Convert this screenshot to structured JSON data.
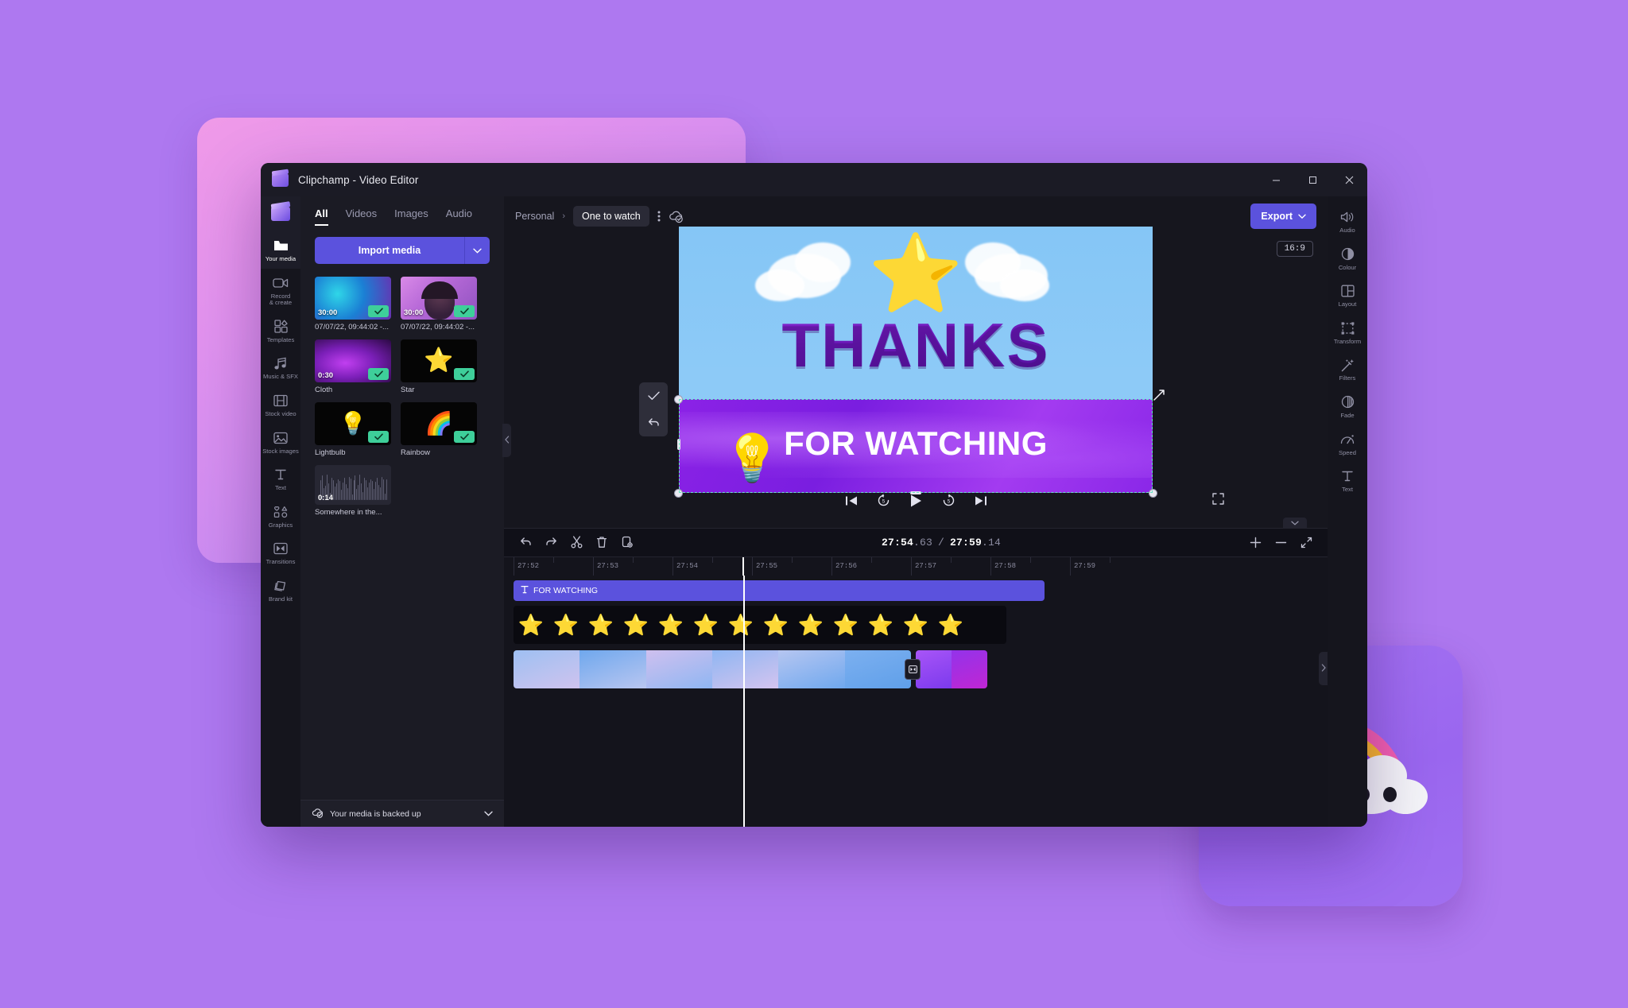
{
  "window": {
    "title": "Clipchamp - Video Editor",
    "controls": {
      "minimize": "—",
      "maximize": "□",
      "close": "✕"
    }
  },
  "left_rail": {
    "items": [
      {
        "label": "Your media",
        "icon": "folder-icon",
        "active": true
      },
      {
        "label": "Record\n& create",
        "icon": "camera-icon",
        "active": false
      },
      {
        "label": "Templates",
        "icon": "templates-icon",
        "active": false
      },
      {
        "label": "Music & SFX",
        "icon": "music-note-icon",
        "active": false
      },
      {
        "label": "Stock video",
        "icon": "film-icon",
        "active": false
      },
      {
        "label": "Stock images",
        "icon": "image-icon",
        "active": false
      },
      {
        "label": "Text",
        "icon": "text-t-icon",
        "active": false
      },
      {
        "label": "Graphics",
        "icon": "shapes-icon",
        "active": false
      },
      {
        "label": "Transitions",
        "icon": "transition-icon",
        "active": false
      },
      {
        "label": "Brand kit",
        "icon": "brand-kit-icon",
        "active": false
      }
    ]
  },
  "media_panel": {
    "tabs": [
      {
        "label": "All",
        "active": true
      },
      {
        "label": "Videos",
        "active": false
      },
      {
        "label": "Images",
        "active": false
      },
      {
        "label": "Audio",
        "active": false
      }
    ],
    "import_button": "Import media",
    "import_caret_icon": "chevron-down-icon",
    "items": [
      {
        "name": "07/07/22, 09:44:02 -...",
        "duration": "30:00",
        "kind": "video",
        "selected": true
      },
      {
        "name": "07/07/22, 09:44:02 -...",
        "duration": "30:00",
        "kind": "video",
        "selected": true
      },
      {
        "name": "Cloth",
        "duration": "0:30",
        "kind": "video",
        "selected": true
      },
      {
        "name": "Star",
        "duration": "",
        "kind": "graphic",
        "selected": true
      },
      {
        "name": "Lightbulb",
        "duration": "",
        "kind": "graphic",
        "selected": true
      },
      {
        "name": "Rainbow",
        "duration": "",
        "kind": "graphic",
        "selected": true
      },
      {
        "name": "Somewhere in the...",
        "duration": "0:14",
        "kind": "audio",
        "selected": false
      }
    ],
    "backup_status": "Your media is backed up",
    "backup_icon": "cloud-check-icon",
    "backup_caret_icon": "chevron-down-icon",
    "collapse_icon": "chevron-left-icon"
  },
  "topbar": {
    "breadcrumb_root": "Personal",
    "breadcrumb_separator": "›",
    "project_name": "One to watch",
    "more_icon": "more-vertical-icon",
    "sync_icon": "cloud-check-icon",
    "export_label": "Export",
    "export_caret_icon": "chevron-down-icon"
  },
  "preview": {
    "aspect_ratio": "16:9",
    "headline": "THANKS",
    "subheadline": "FOR WATCHING",
    "floating_tools": [
      {
        "icon": "check-icon",
        "name": "confirm"
      },
      {
        "icon": "undo-icon",
        "name": "revert"
      }
    ],
    "rotate_icon": "rotate-handle-icon",
    "playback_controls": [
      {
        "icon": "skip-start-icon",
        "name": "jump-to-start"
      },
      {
        "icon": "rewind-5-icon",
        "name": "rewind-five-seconds"
      },
      {
        "icon": "play-icon",
        "name": "play"
      },
      {
        "icon": "forward-5-icon",
        "name": "forward-five-seconds"
      },
      {
        "icon": "skip-end-icon",
        "name": "jump-to-end"
      }
    ],
    "fullscreen_icon": "fullscreen-icon"
  },
  "timeline": {
    "collapse_icon": "chevron-down-icon",
    "tools": [
      {
        "icon": "undo-icon",
        "name": "undo"
      },
      {
        "icon": "redo-icon",
        "name": "redo"
      },
      {
        "icon": "scissors-icon",
        "name": "split"
      },
      {
        "icon": "trash-icon",
        "name": "delete"
      },
      {
        "icon": "duplicate-icon",
        "name": "duplicate"
      }
    ],
    "current_time_major": "27:54",
    "current_time_minor": ".63",
    "total_time_major": "27:59",
    "total_time_minor": ".14",
    "time_separator": "/",
    "zoom_in_icon": "plus-icon",
    "zoom_out_icon": "minus-icon",
    "fit_icon": "fit-to-screen-icon",
    "ruler_ticks": [
      "27:52",
      "27:53",
      "27:54",
      "27:55",
      "27:56",
      "27:57",
      "27:58",
      "27:59"
    ],
    "text_clip": {
      "label": "FOR WATCHING",
      "icon": "text-t-icon"
    },
    "sticker_clip": {
      "emoji": "⭐",
      "count": 13
    },
    "transition_marker_icon": "transition-icon"
  },
  "right_rail": {
    "items": [
      {
        "label": "Audio",
        "icon": "speaker-icon"
      },
      {
        "label": "Colour",
        "icon": "contrast-icon"
      },
      {
        "label": "Layout",
        "icon": "layout-icon"
      },
      {
        "label": "Transform",
        "icon": "transform-icon"
      },
      {
        "label": "Filters",
        "icon": "magic-wand-icon"
      },
      {
        "label": "Fade",
        "icon": "fade-icon"
      },
      {
        "label": "Speed",
        "icon": "speedometer-icon"
      },
      {
        "label": "Text",
        "icon": "text-t-icon"
      }
    ],
    "collapse_icon": "chevron-right-icon"
  },
  "colors": {
    "page_background": "#ae78f0",
    "accent": "#5b52dd",
    "window_background": "#16161e",
    "panel_background": "#1b1b24",
    "rail_background": "#15151d",
    "check_badge": "#3ecf9a",
    "selection_outline": "#67e3c4"
  }
}
